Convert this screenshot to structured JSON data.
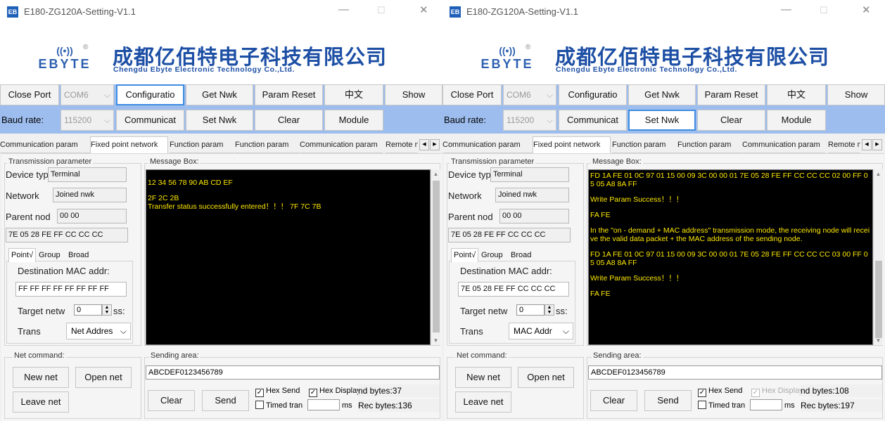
{
  "windows": [
    {
      "title": "E180-ZG120A-Setting-V1.1",
      "app_icon": "EB",
      "controls": {
        "minimize": "—",
        "maximize": "☐",
        "close": "✕"
      },
      "banner": {
        "logo_text": "EBYTE",
        "logo_waves": "((•))",
        "registered": "®",
        "company_cn": "成都亿佰特电子科技有限公司",
        "company_en": "Chengdu Ebyte Electronic Technology Co.,Ltd."
      },
      "toolbar": {
        "close_port": "Close Port",
        "port": "COM6",
        "configuration": "Configuratio",
        "get_nwk": "Get Nwk",
        "param_reset": "Param Reset",
        "lang": "中文",
        "show": "Show",
        "baud_label": "Baud rate:",
        "baud": "115200",
        "communicate": "Communicat",
        "set_nwk": "Set Nwk",
        "clear": "Clear",
        "module": "Module",
        "active": "configuration"
      },
      "tabs": [
        "Communication param",
        "Fixed point network",
        "Function param",
        "Function param",
        "Communication param",
        "Remote n"
      ],
      "selected_tab": 1,
      "transmission": {
        "title": "Transmission parameter",
        "device_type_label": "Device typ",
        "device_type": "Terminal",
        "network_label": "Network",
        "network": "Joined nwk",
        "parent_label": "Parent nod",
        "parent": "00 00",
        "mac": "7E 05 28 FE FF CC CC CC",
        "inner_tabs": [
          "Point√",
          "Group",
          "Broad"
        ],
        "dest_mac_label": "Destination MAC addr:",
        "dest_mac": "FF FF FF FF FF FF FF FF",
        "target_label_a": "Target netw",
        "target_value": "0",
        "target_label_b": "ss:",
        "trans_label": "Trans",
        "trans_mode": "Net Addres"
      },
      "message_box": {
        "title": "Message Box:",
        "lines": [
          "",
          "12 34 56 78 90 AB CD EF",
          "",
          "2F 2C 2B",
          "Transfer status successfully entered！！！ 7F 7C 7B"
        ]
      },
      "net_command": {
        "title": "Net command:",
        "new_net": "New net",
        "open_net": "Open net",
        "leave_net": "Leave net"
      },
      "sending": {
        "title": "Sending area:",
        "text": "ABCDEF0123456789",
        "clear": "Clear",
        "send": "Send",
        "hex_send": "Hex Send",
        "hex_send_checked": true,
        "hex_display": "Hex Display",
        "hex_display_checked": true,
        "hex_display_disabled": false,
        "timed": "Timed tran",
        "timed_checked": false,
        "ms": "ms",
        "send_bytes": "nd bytes:37",
        "rec_bytes": "Rec bytes:136"
      }
    },
    {
      "title": "E180-ZG120A-Setting-V1.1",
      "app_icon": "EB",
      "controls": {
        "minimize": "—",
        "maximize": "☐",
        "close": "✕"
      },
      "banner": {
        "logo_text": "EBYTE",
        "logo_waves": "((•))",
        "registered": "®",
        "company_cn": "成都亿佰特电子科技有限公司",
        "company_en": "Chengdu Ebyte Electronic Technology Co.,Ltd."
      },
      "toolbar": {
        "close_port": "Close Port",
        "port": "COM6",
        "configuration": "Configuratio",
        "get_nwk": "Get Nwk",
        "param_reset": "Param Reset",
        "lang": "中文",
        "show": "Show",
        "baud_label": "Baud rate:",
        "baud": "115200",
        "communicate": "Communicat",
        "set_nwk": "Set Nwk",
        "clear": "Clear",
        "module": "Module",
        "active": "set_nwk"
      },
      "tabs": [
        "Communication param",
        "Fixed point network",
        "Function param",
        "Function param",
        "Communication param",
        "Remote n"
      ],
      "selected_tab": 1,
      "transmission": {
        "title": "Transmission parameter",
        "device_type_label": "Device typ",
        "device_type": "Terminal",
        "network_label": "Network",
        "network": "Joined nwk",
        "parent_label": "Parent nod",
        "parent": "00 00",
        "mac": "7E 05 28 FE FF CC CC CC",
        "inner_tabs": [
          "Point√",
          "Group",
          "Broad"
        ],
        "dest_mac_label": "Destination MAC addr:",
        "dest_mac": "7E 05 28 FE FF CC CC CC",
        "target_label_a": "Target netw",
        "target_value": "0",
        "target_label_b": "ss:",
        "trans_label": "Trans",
        "trans_mode": "MAC Addr"
      },
      "message_box": {
        "title": "Message Box:",
        "lines": [
          "FD 1A FE 01 0C 97 01 15 00 09 3C 00 00 01 7E 05 28 FE FF CC CC CC 02 00 FF 05 05 A8 8A FF",
          "",
          "Write Param Success！！！",
          "",
          "FA FE",
          "",
          "In the \"on - demand + MAC address\" transmission mode, the receiving node will receive the valid data packet + the MAC address of the sending node.",
          "",
          "FD 1A FE 01 0C 97 01 15 00 09 3C 00 00 01 7E 05 28 FE FF CC CC CC 03 00 FF 05 05 A8 8A FF",
          "",
          "Write Param Success！！！",
          "",
          "FA FE"
        ]
      },
      "net_command": {
        "title": "Net command:",
        "new_net": "New net",
        "open_net": "Open net",
        "leave_net": "Leave net"
      },
      "sending": {
        "title": "Sending area:",
        "text": "ABCDEF0123456789",
        "clear": "Clear",
        "send": "Send",
        "hex_send": "Hex Send",
        "hex_send_checked": true,
        "hex_display": "Hex Display",
        "hex_display_checked": true,
        "hex_display_disabled": true,
        "timed": "Timed tran",
        "timed_checked": false,
        "ms": "ms",
        "send_bytes": "nd bytes:108",
        "rec_bytes": "Rec bytes:197"
      }
    }
  ],
  "colors": {
    "toolbar": "#9dbdee",
    "brand": "#1d4fa5",
    "message_bg": "#000000",
    "message_text": "#ffea00",
    "active_border": "#3f8de0"
  }
}
